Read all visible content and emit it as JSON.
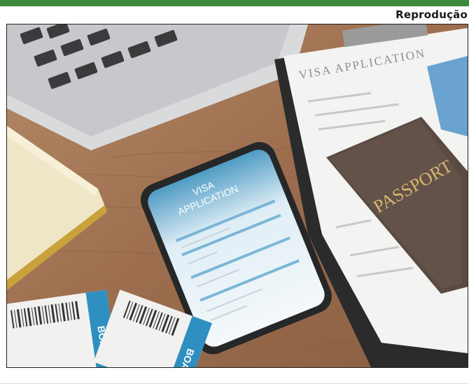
{
  "credit": "Reprodução",
  "photo_text": {
    "form_heading": "VISA APPLICATION",
    "phone_heading_line1": "VISA",
    "phone_heading_line2": "APPLICATION",
    "passport": "PASSPORT",
    "boarding_pass_left": "BOARD",
    "boarding_pass_right": "BOARD"
  },
  "colors": {
    "accent_bar": "#3d8a3d",
    "desk_wood": "#a07556",
    "passport_cover": "#5a4a42",
    "phone_ui": "#4f9bc4"
  }
}
